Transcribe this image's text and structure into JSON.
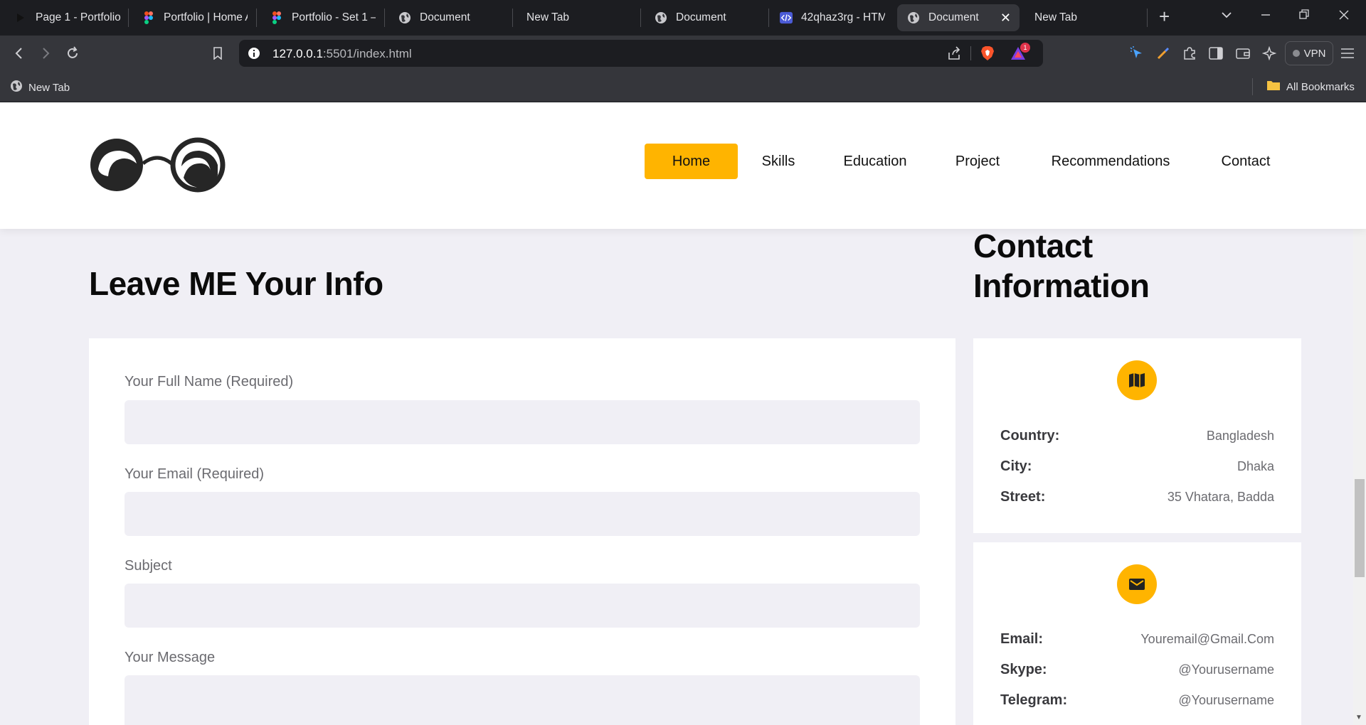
{
  "browser": {
    "tabs": [
      {
        "title": "Page 1 - Portfolio",
        "icon": "play-icon",
        "active": false
      },
      {
        "title": "Portfolio | Home A",
        "icon": "figma-icon",
        "active": false
      },
      {
        "title": "Portfolio - Set 1 –",
        "icon": "figma-icon",
        "active": false
      },
      {
        "title": "Document",
        "icon": "globe-icon",
        "active": false
      },
      {
        "title": "New Tab",
        "icon": "",
        "active": false
      },
      {
        "title": "Document",
        "icon": "globe-icon",
        "active": false
      },
      {
        "title": "42qhaz3rg - HTM",
        "icon": "code-icon",
        "active": false
      },
      {
        "title": "Document",
        "icon": "globe-icon",
        "active": true
      },
      {
        "title": "New Tab",
        "icon": "",
        "active": false
      }
    ],
    "new_tab_label": "+",
    "url_host": "127.0.0.1",
    "url_rest": ":5501/index.html",
    "vpn_label": "VPN",
    "notification_count": "1",
    "bookmarks": {
      "new_tab": "New Tab",
      "all_bookmarks": "All Bookmarks"
    }
  },
  "site": {
    "nav": [
      {
        "label": "Home",
        "active": true
      },
      {
        "label": "Skills",
        "active": false
      },
      {
        "label": "Education",
        "active": false
      },
      {
        "label": "Project",
        "active": false
      },
      {
        "label": "Recommendations",
        "active": false
      },
      {
        "label": "Contact",
        "active": false
      }
    ],
    "form_heading": "Leave ME Your Info",
    "contact_heading_line1": "Contact",
    "contact_heading_line2": "Information",
    "form": {
      "name_label": "Your Full Name (Required)",
      "email_label": "Your Email (Required)",
      "subject_label": "Subject",
      "message_label": "Your Message"
    },
    "address_card": {
      "icon": "map-icon",
      "rows": [
        {
          "key": "Country:",
          "value": "Bangladesh"
        },
        {
          "key": "City:",
          "value": "Dhaka"
        },
        {
          "key": "Street:",
          "value": "35 Vhatara, Badda"
        }
      ]
    },
    "contact_card": {
      "icon": "mail-icon",
      "rows": [
        {
          "key": "Email:",
          "value": "Youremail@Gmail.Com"
        },
        {
          "key": "Skype:",
          "value": "@Yourusername"
        },
        {
          "key": "Telegram:",
          "value": "@Yourusername"
        }
      ]
    },
    "accent_color": "#ffb400"
  }
}
